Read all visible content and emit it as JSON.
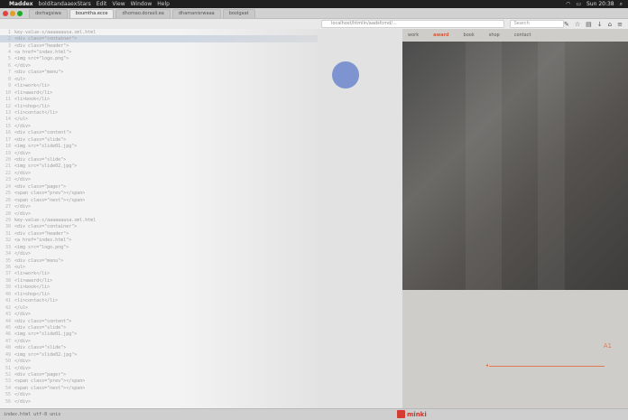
{
  "menubar": {
    "app_name": "Maddex",
    "items": [
      "bolditandaaexStars",
      "Edit",
      "View",
      "Window",
      "Help"
    ],
    "clock": "Sun 20:38"
  },
  "browser": {
    "tabs": [
      {
        "label": "dorhagsiwa",
        "active": false
      },
      {
        "label": "boumtha.ecce",
        "active": true
      },
      {
        "label": "dhomao.dorasil.ea",
        "active": false
      },
      {
        "label": "dhamanisrwaaa",
        "active": false
      },
      {
        "label": "boolgaat",
        "active": false
      }
    ],
    "url": "localhost/htmlin/aadsfcmd/...",
    "search_placeholder": "Search"
  },
  "editor": {
    "lines": [
      "key-value-s/aaaaaaasa.xml.html",
      "<div class=\"container\">",
      "  <div class=\"header\">",
      "    <a href=\"index.html\">",
      "    <img src=\"logo.png\">",
      "  </div>",
      "  <div class=\"menu\">",
      "    <ul>",
      "      <li>work</li>",
      "      <li>award</li>",
      "      <li>book</li>",
      "      <li>shop</li>",
      "      <li>contact</li>",
      "    </ul>",
      "  </div>",
      "  <div class=\"content\">",
      "    <div class=\"slide\">",
      "      <img src=\"slide01.jpg\">",
      "    </div>",
      "    <div class=\"slide\">",
      "      <img src=\"slide02.jpg\">",
      "    </div>",
      "  </div>",
      "  <div class=\"pager\">",
      "    <span class=\"prev\"></span>",
      "    <span class=\"next\"></span>",
      "  </div>",
      "</div>"
    ]
  },
  "site": {
    "nav": [
      {
        "label": "work",
        "active": false
      },
      {
        "label": "award",
        "active": true
      },
      {
        "label": "book",
        "active": false
      },
      {
        "label": "shop",
        "active": false
      },
      {
        "label": "contact",
        "active": false
      }
    ],
    "page_number": "A1"
  },
  "statusbar": {
    "command": "index.html  utf-8  unix",
    "logo_text": "minki"
  }
}
